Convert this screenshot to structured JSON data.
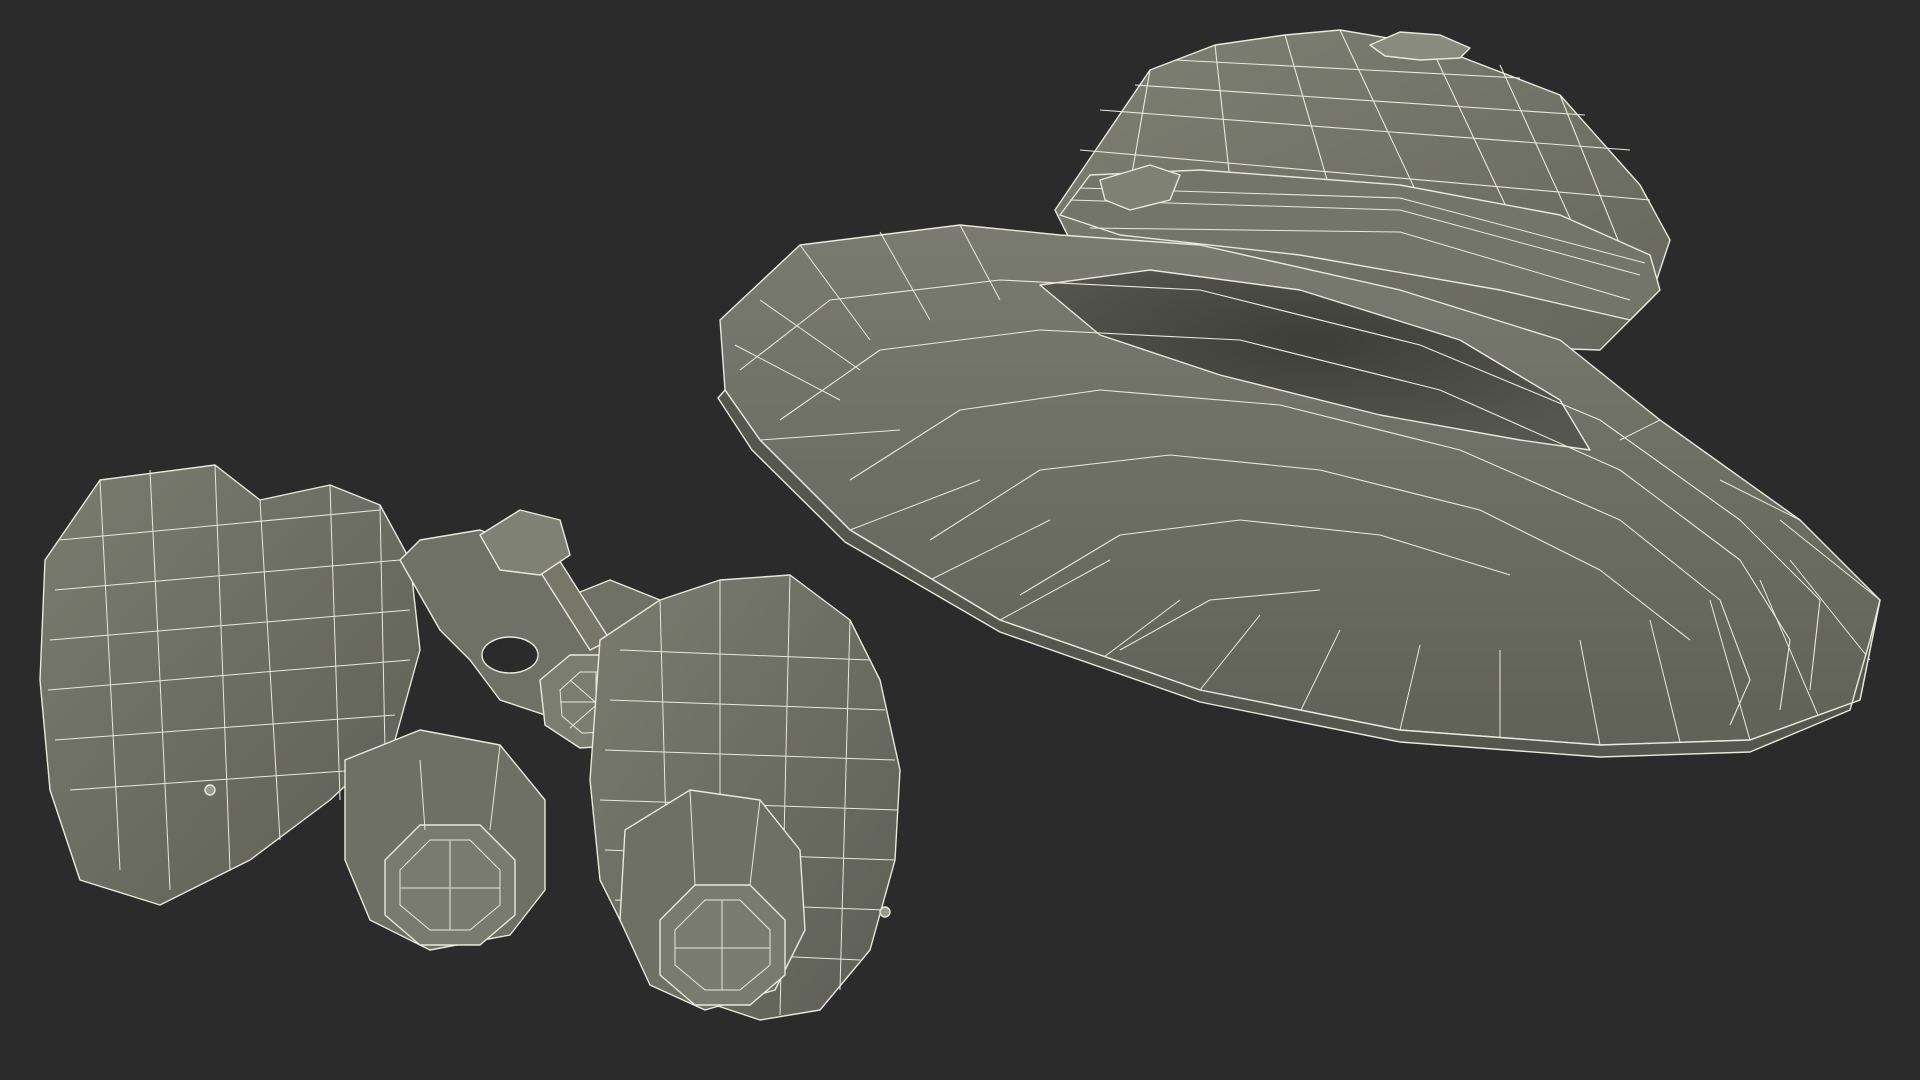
{
  "scene": {
    "background_color": "#2b2b2b",
    "mesh_fill_color": "#6e6f63",
    "mesh_fill_light": "#7c7d71",
    "mesh_fill_dark": "#4f5048",
    "wire_color": "#e8e8dc",
    "objects": [
      {
        "name": "binoculars"
      },
      {
        "name": "pith-helmet"
      }
    ]
  }
}
